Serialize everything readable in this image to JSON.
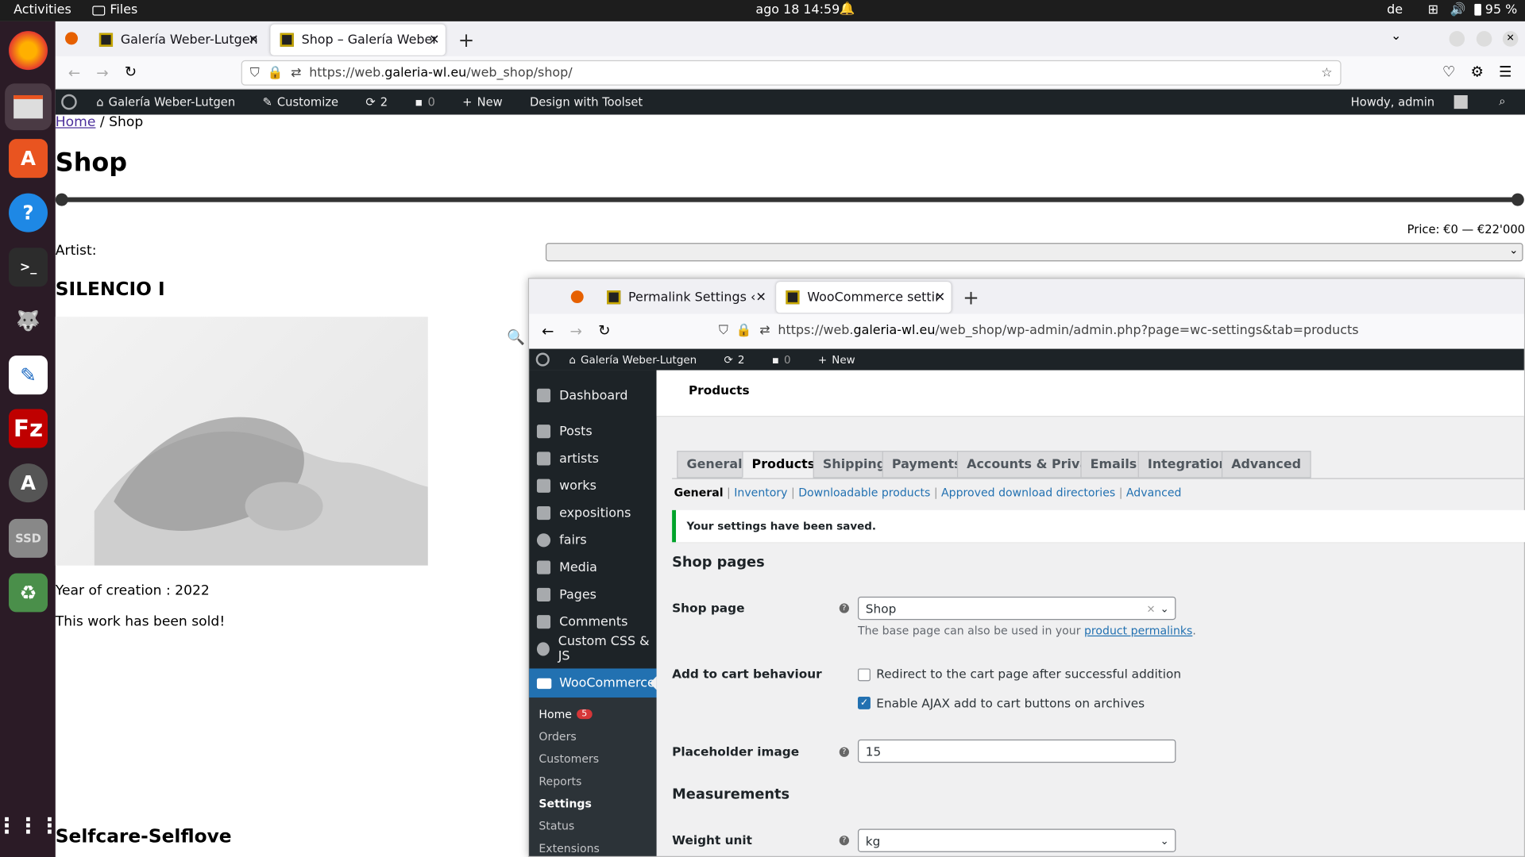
{
  "system": {
    "activities": "Activities",
    "files": "Files",
    "datetime": "ago 18  14:59",
    "lang": "de",
    "battery": "95 %"
  },
  "browser1": {
    "tabs": [
      {
        "label": "Galería Weber-Lutgen"
      },
      {
        "label": "Shop – Galería Weber-Lut"
      }
    ],
    "url_prefix": "https://web.",
    "url_host": "galeria-wl.eu",
    "url_path": "/web_shop/shop/"
  },
  "adminbar1": {
    "site": "Galería Weber-Lutgen",
    "customize": "Customize",
    "updates": "2",
    "comments": "0",
    "new": "New",
    "toolset": "Design with Toolset",
    "howdy": "Howdy, admin"
  },
  "shop": {
    "breadcrumb_home": "Home",
    "breadcrumb_sep": " / Shop",
    "title": "Shop",
    "price": "Price: €0 — €22'000",
    "artist_label": "Artist:",
    "product1_title": "SILENCIO I",
    "product1_year": "Year of creation : 2022",
    "product1_status": "This work has been sold!",
    "product2_title": "Selfcare-Selflove"
  },
  "browser2": {
    "tabs": [
      {
        "label": "Permalink Settings ‹ Gale"
      },
      {
        "label": "WooCommerce settings ‹"
      }
    ],
    "url_prefix": "https://web.",
    "url_host": "galeria-wl.eu",
    "url_path": "/web_shop/wp-admin/admin.php?page=wc-settings&tab=products"
  },
  "adminbar2": {
    "site": "Galería Weber-Lutgen",
    "updates": "2",
    "comments": "0",
    "new": "New"
  },
  "sidebar": {
    "items": [
      "Dashboard",
      "Posts",
      "artists",
      "works",
      "expositions",
      "fairs",
      "Media",
      "Pages",
      "Comments",
      "Custom CSS & JS"
    ],
    "woo": "WooCommerce",
    "sub": [
      "Home",
      "Orders",
      "Customers",
      "Reports",
      "Settings",
      "Status",
      "Extensions"
    ],
    "home_badge": "5"
  },
  "settings": {
    "header": "Products",
    "tabs": [
      "General",
      "Products",
      "Shipping",
      "Payments",
      "Accounts & Privacy",
      "Emails",
      "Integration",
      "Advanced"
    ],
    "subtabs": [
      "General",
      "Inventory",
      "Downloadable products",
      "Approved download directories",
      "Advanced"
    ],
    "notice": "Your settings have been saved.",
    "section_shop_pages": "Shop pages",
    "shop_page_label": "Shop page",
    "shop_page_value": "Shop",
    "shop_page_desc": "The base page can also be used in your ",
    "shop_page_link": "product permalinks",
    "shop_page_desc_end": ".",
    "cart_label": "Add to cart behaviour",
    "cart_opt1": "Redirect to the cart page after successful addition",
    "cart_opt2": "Enable AJAX add to cart buttons on archives",
    "placeholder_label": "Placeholder image",
    "placeholder_value": "15",
    "section_measurements": "Measurements",
    "weight_label": "Weight unit",
    "weight_value": "kg"
  },
  "colors": {
    "wp_dark": "#1d2327",
    "woo_blue": "#2271b1",
    "notice_green": "#00a32a",
    "badge_red": "#d63638"
  }
}
